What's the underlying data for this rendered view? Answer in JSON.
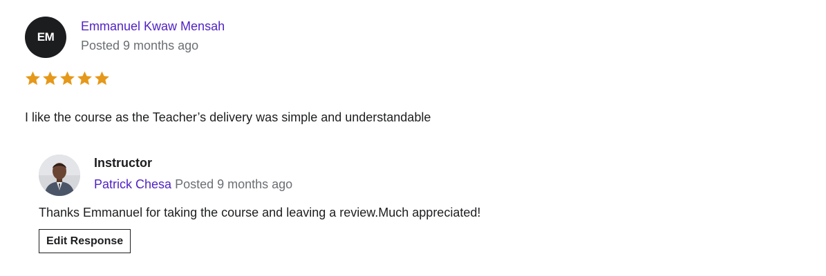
{
  "review": {
    "avatar_initials": "EM",
    "reviewer_name": "Emmanuel Kwaw Mensah",
    "posted": "Posted 9 months ago",
    "rating": 5,
    "rating_max": 5,
    "star_color": "#e59819",
    "text": "I like the course as the Teacher’s delivery was simple and understandable"
  },
  "response": {
    "role": "Instructor",
    "instructor_name": "Patrick Chesa",
    "posted": "Posted 9 months ago",
    "text": "Thanks Emmanuel for taking the course and leaving a review.Much appreciated!",
    "edit_button_label": "Edit Response"
  },
  "colors": {
    "link_purple": "#5022c3",
    "muted_gray": "#6a6f73",
    "text_dark": "#1c1d1f"
  }
}
